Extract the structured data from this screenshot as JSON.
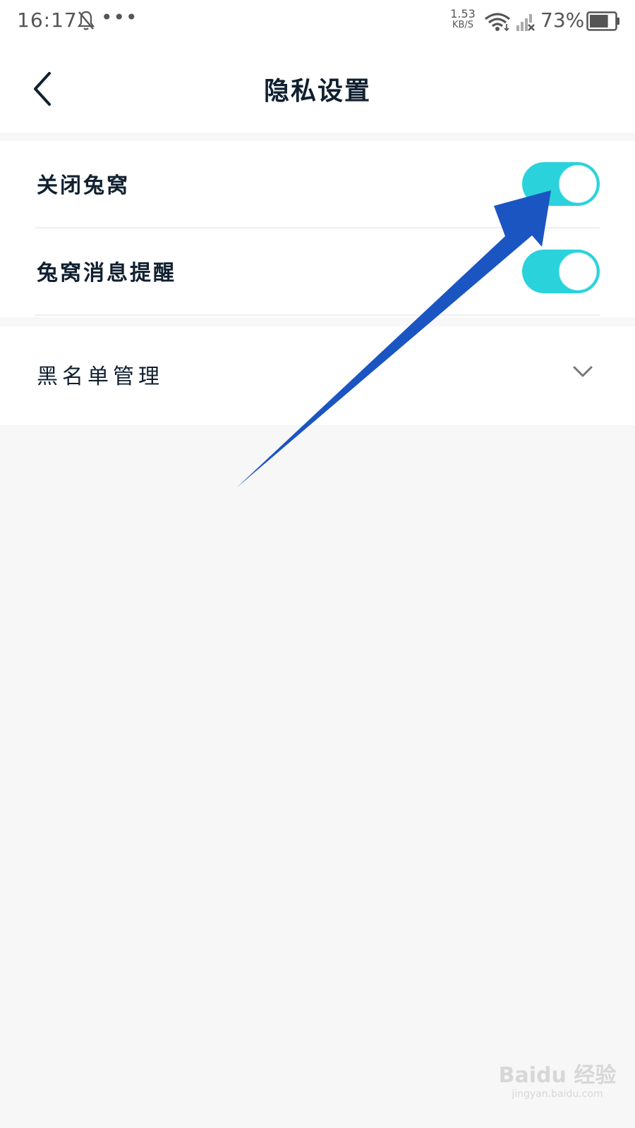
{
  "status_bar": {
    "time": "16:17",
    "more": "•••",
    "net_speed_value": "1.53",
    "net_speed_unit": "KB/S",
    "battery": "73%",
    "battery_level": 0.73
  },
  "header": {
    "title": "隐私设置"
  },
  "settings": {
    "close_tuwo": {
      "label": "关闭兔窝",
      "enabled": true
    },
    "tuwo_notify": {
      "label": "兔窝消息提醒",
      "enabled": true
    }
  },
  "blacklist": {
    "label": "黑名单管理"
  },
  "colors": {
    "toggle_on": "#2ad2dc",
    "annotation_arrow": "#1a55c2",
    "title_text": "#102030",
    "background": "#f7f7f7"
  },
  "watermark": {
    "brand": "Baidu 经验",
    "site": "jingyan.baidu.com"
  }
}
